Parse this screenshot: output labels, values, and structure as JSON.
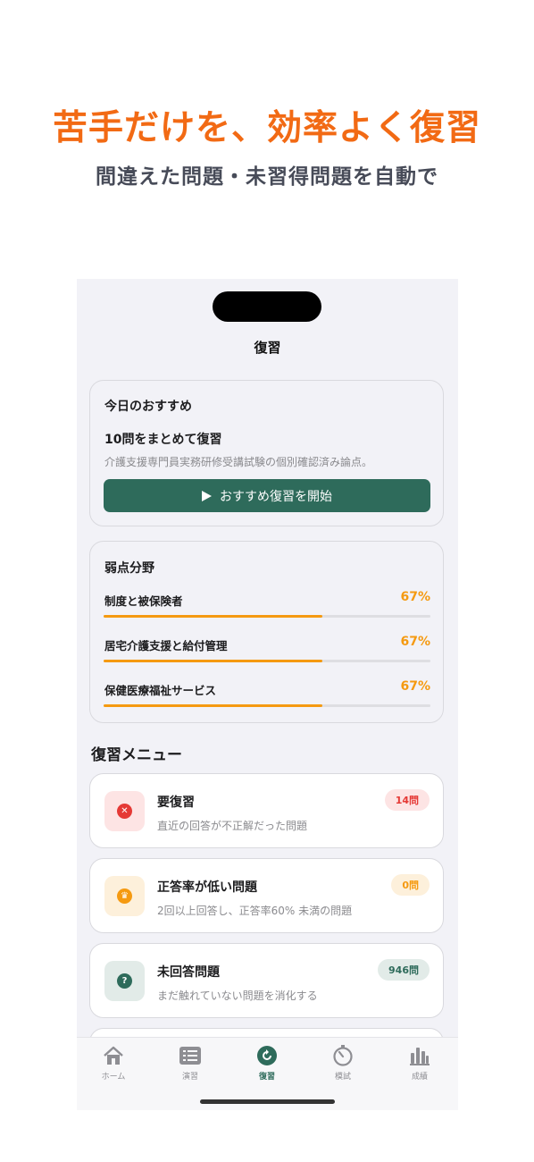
{
  "promo": {
    "headline": "苦手だけを、効率よく復習",
    "subheadline": "間違えた問題・未習得問題を自動で"
  },
  "nav": {
    "title": "復習"
  },
  "recommendation": {
    "heading": "今日のおすすめ",
    "title": "10問をまとめて復習",
    "description": "介護支援専門員実務研修受講試験の個別確認済み論点。",
    "button_label": "おすすめ復習を開始"
  },
  "weak_areas": {
    "heading": "弱点分野",
    "items": [
      {
        "label": "制度と被保険者",
        "percent_text": "67%",
        "progress": 0.67
      },
      {
        "label": "居宅介護支援と給付管理",
        "percent_text": "67%",
        "progress": 0.67
      },
      {
        "label": "保健医療福祉サービス",
        "percent_text": "67%",
        "progress": 0.67
      }
    ]
  },
  "review_menu": {
    "heading": "復習メニュー",
    "items": [
      {
        "icon": "x-circle-icon",
        "title": "要復習",
        "description": "直近の回答が不正解だった問題",
        "badge": "14問",
        "badge_color": "#e53935",
        "icon_color": "#e53935"
      },
      {
        "icon": "crown-icon",
        "title": "正答率が低い問題",
        "description": "2回以上回答し、正答率60% 未満の問題",
        "badge": "0問",
        "badge_color": "#f59a11",
        "icon_color": "#f59a11"
      },
      {
        "icon": "question-circle-icon",
        "title": "未回答問題",
        "description": "まだ触れていない問題を消化する",
        "badge": "946問",
        "badge_color": "#2e6b5b",
        "icon_color": "#2e6b5b"
      }
    ]
  },
  "tabs": [
    {
      "icon": "home-icon",
      "label": "ホーム"
    },
    {
      "icon": "list-icon",
      "label": "演習"
    },
    {
      "icon": "review-icon",
      "label": "復習",
      "active": true
    },
    {
      "icon": "timer-icon",
      "label": "模試"
    },
    {
      "icon": "bar-chart-icon",
      "label": "成績"
    }
  ],
  "colors": {
    "accent_orange": "#f26a14",
    "primary_green": "#2e6b5b",
    "progress_orange": "#f59a11",
    "danger_red": "#e53935"
  }
}
